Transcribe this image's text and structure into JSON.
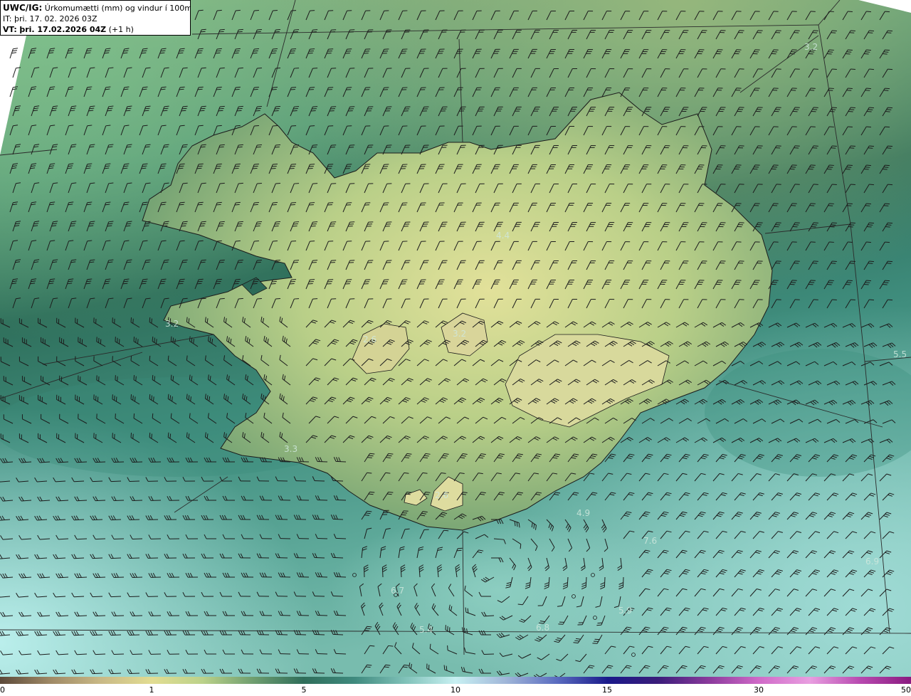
{
  "header": {
    "product": "UWC/IG:",
    "title": "Úrkomumætti (mm) og vindur í 100m hæð",
    "init_prefix": "IT:",
    "init_time": "þri. 17. 02. 2026 03Z",
    "valid_prefix": "VT:",
    "valid_time": "þri. 17.02.2026 04Z",
    "lead": "(+1 h)"
  },
  "colorbar": {
    "ticks": [
      {
        "label": "0",
        "value": 0
      },
      {
        "label": "1",
        "value": 1
      },
      {
        "label": "5",
        "value": 5
      },
      {
        "label": "10",
        "value": 10
      },
      {
        "label": "15",
        "value": 15
      },
      {
        "label": "30",
        "value": 30
      },
      {
        "label": "50",
        "value": 50
      }
    ],
    "colors": [
      "#5c4a3a",
      "#a08a66",
      "#c9b986",
      "#e2dd92",
      "#bcd28a",
      "#6f9e6f",
      "#2f6e5a",
      "#3f8a7e",
      "#7fc1b8",
      "#c8f0f2",
      "#9fb5d8",
      "#5a6cc0",
      "#1a1a8a",
      "#3a1c7a",
      "#8a3a9c",
      "#d06ac8",
      "#e89ee0",
      "#b84ab0",
      "#8a1a80"
    ]
  },
  "point_values": [
    "3.2",
    "4.4",
    "3.2",
    "2.6",
    "3.2",
    "5.5",
    "3.3",
    "2.6",
    "4.9",
    "7.6",
    "6.9",
    "6.7",
    "5.9",
    "5.4",
    "6.8"
  ],
  "colors": {
    "ocean_dark": "#2e6c57",
    "ocean_teal": "#5aa999",
    "ocean_light": "#a9e4e4",
    "land_green": "#8eb47a",
    "land_yellow": "#d9dc93",
    "wind_barb": "#1c1c1c",
    "grid_line": "#2a2a2a"
  },
  "wind_barb_icon": "wind-barb-icon"
}
